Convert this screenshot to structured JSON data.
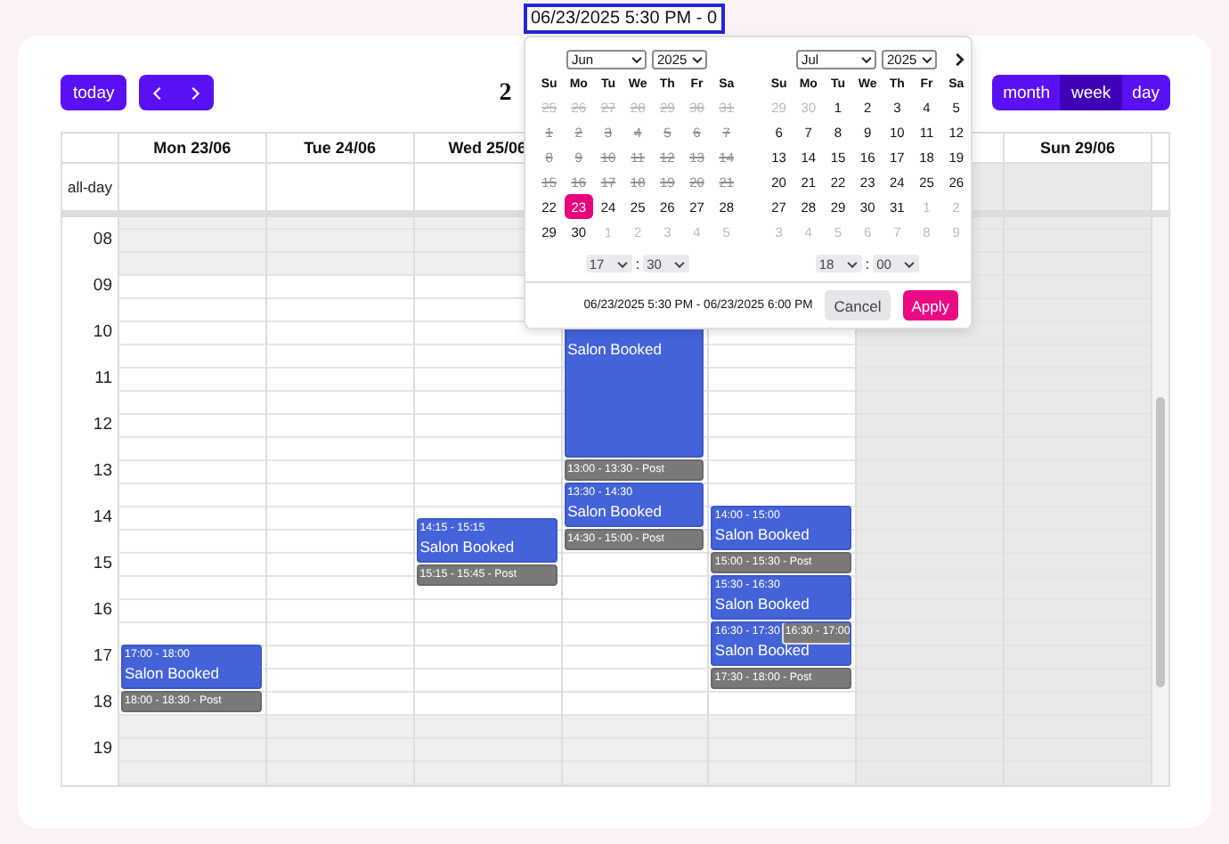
{
  "range_input": {
    "value": "06/23/2025 5:30 PM - 0"
  },
  "toolbar": {
    "today": "today",
    "title": "2",
    "views": [
      {
        "label": "month",
        "selected": false
      },
      {
        "label": "week",
        "selected": true
      },
      {
        "label": "day",
        "selected": false
      }
    ]
  },
  "calendar": {
    "all_day_label": "all-day",
    "hours": [
      "08",
      "09",
      "10",
      "11",
      "12",
      "13",
      "14",
      "15",
      "16",
      "17",
      "18",
      "19"
    ],
    "days": [
      {
        "header": "Mon 23/06",
        "weekend": false,
        "events": [
          {
            "kind": "booking",
            "time": "17:00 - 18:00",
            "title": "Salon Booked"
          },
          {
            "kind": "post",
            "time": "18:00 - 18:30 - Post"
          }
        ]
      },
      {
        "header": "Tue 24/06",
        "weekend": false
      },
      {
        "header": "Wed 25/06",
        "weekend": false,
        "events": [
          {
            "kind": "booking",
            "time": "14:15 - 15:15",
            "title": "Salon Booked"
          },
          {
            "kind": "post",
            "time": "15:15 - 15:45 - Post"
          }
        ]
      },
      {
        "weekend": false,
        "events": [
          {
            "kind": "booking",
            "title": "Salon Booked"
          },
          {
            "kind": "post",
            "time": "13:00 - 13:30 - Post"
          },
          {
            "kind": "booking",
            "time": "13:30 - 14:30",
            "title": "Salon Booked"
          },
          {
            "kind": "post",
            "time": "14:30 - 15:00 - Post"
          }
        ]
      },
      {
        "weekend": false,
        "events": [
          {
            "kind": "booking",
            "time": "14:00 - 15:00",
            "title": "Salon Booked"
          },
          {
            "kind": "post",
            "time": "15:00 - 15:30 - Post"
          },
          {
            "kind": "booking",
            "time": "15:30 - 16:30",
            "title": "Salon Booked"
          },
          {
            "kind": "booking",
            "time": "16:30 - 17:30",
            "title": "Salon Booked"
          },
          {
            "kind": "post",
            "time": "16:30 - 17:00",
            "inset": true
          },
          {
            "kind": "post",
            "time": "17:30 - 18:00 - Post"
          }
        ]
      },
      {
        "weekend": true
      },
      {
        "header": "Sun 29/06",
        "weekend": true
      }
    ]
  },
  "picker": {
    "months": [
      {
        "month": "Jun",
        "year": "2025",
        "weekdays": [
          "Su",
          "Mo",
          "Tu",
          "We",
          "Th",
          "Fr",
          "Sa"
        ],
        "weeks": [
          [
            {
              "label": "25",
              "outside": true,
              "disabled": true,
              "selected": false
            },
            {
              "label": "26",
              "outside": true,
              "disabled": true,
              "selected": false
            },
            {
              "label": "27",
              "outside": true,
              "disabled": true,
              "selected": false
            },
            {
              "label": "28",
              "outside": true,
              "disabled": true,
              "selected": false
            },
            {
              "label": "29",
              "outside": true,
              "disabled": true,
              "selected": false
            },
            {
              "label": "30",
              "outside": true,
              "disabled": true,
              "selected": false
            },
            {
              "label": "31",
              "outside": true,
              "disabled": true,
              "selected": false
            }
          ],
          [
            {
              "label": "1",
              "outside": false,
              "disabled": true,
              "selected": false
            },
            {
              "label": "2",
              "outside": false,
              "disabled": true,
              "selected": false
            },
            {
              "label": "3",
              "outside": false,
              "disabled": true,
              "selected": false
            },
            {
              "label": "4",
              "outside": false,
              "disabled": true,
              "selected": false
            },
            {
              "label": "5",
              "outside": false,
              "disabled": true,
              "selected": false
            },
            {
              "label": "6",
              "outside": false,
              "disabled": true,
              "selected": false
            },
            {
              "label": "7",
              "outside": false,
              "disabled": true,
              "selected": false
            }
          ],
          [
            {
              "label": "8",
              "outside": false,
              "disabled": true,
              "selected": false
            },
            {
              "label": "9",
              "outside": false,
              "disabled": true,
              "selected": false
            },
            {
              "label": "10",
              "outside": false,
              "disabled": true,
              "selected": false
            },
            {
              "label": "11",
              "outside": false,
              "disabled": true,
              "selected": false
            },
            {
              "label": "12",
              "outside": false,
              "disabled": true,
              "selected": false
            },
            {
              "label": "13",
              "outside": false,
              "disabled": true,
              "selected": false
            },
            {
              "label": "14",
              "outside": false,
              "disabled": true,
              "selected": false
            }
          ],
          [
            {
              "label": "15",
              "outside": false,
              "disabled": true,
              "selected": false
            },
            {
              "label": "16",
              "outside": false,
              "disabled": true,
              "selected": false
            },
            {
              "label": "17",
              "outside": false,
              "disabled": true,
              "selected": false
            },
            {
              "label": "18",
              "outside": false,
              "disabled": true,
              "selected": false
            },
            {
              "label": "19",
              "outside": false,
              "disabled": true,
              "selected": false
            },
            {
              "label": "20",
              "outside": false,
              "disabled": true,
              "selected": false
            },
            {
              "label": "21",
              "outside": false,
              "disabled": true,
              "selected": false
            }
          ],
          [
            {
              "label": "22",
              "outside": false,
              "disabled": false,
              "selected": false
            },
            {
              "label": "23",
              "outside": false,
              "disabled": false,
              "selected": true
            },
            {
              "label": "24",
              "outside": false,
              "disabled": false,
              "selected": false
            },
            {
              "label": "25",
              "outside": false,
              "disabled": false,
              "selected": false
            },
            {
              "label": "26",
              "outside": false,
              "disabled": false,
              "selected": false
            },
            {
              "label": "27",
              "outside": false,
              "disabled": false,
              "selected": false
            },
            {
              "label": "28",
              "outside": false,
              "disabled": false,
              "selected": false
            }
          ],
          [
            {
              "label": "29",
              "outside": false,
              "disabled": false,
              "selected": false
            },
            {
              "label": "30",
              "outside": false,
              "disabled": false,
              "selected": false
            },
            {
              "label": "1",
              "outside": true,
              "disabled": false,
              "selected": false
            },
            {
              "label": "2",
              "outside": true,
              "disabled": false,
              "selected": false
            },
            {
              "label": "3",
              "outside": true,
              "disabled": false,
              "selected": false
            },
            {
              "label": "4",
              "outside": true,
              "disabled": false,
              "selected": false
            },
            {
              "label": "5",
              "outside": true,
              "disabled": false,
              "selected": false
            }
          ]
        ],
        "time": {
          "hour": "17",
          "separator": ":",
          "minute": "30"
        }
      },
      {
        "month": "Jul",
        "year": "2025",
        "weekdays": [
          "Su",
          "Mo",
          "Tu",
          "We",
          "Th",
          "Fr",
          "Sa"
        ],
        "weeks": [
          [
            {
              "label": "29",
              "outside": true,
              "disabled": false,
              "selected": false
            },
            {
              "label": "30",
              "outside": true,
              "disabled": false,
              "selected": false
            },
            {
              "label": "1",
              "outside": false,
              "disabled": false,
              "selected": false
            },
            {
              "label": "2",
              "outside": false,
              "disabled": false,
              "selected": false
            },
            {
              "label": "3",
              "outside": false,
              "disabled": false,
              "selected": false
            },
            {
              "label": "4",
              "outside": false,
              "disabled": false,
              "selected": false
            },
            {
              "label": "5",
              "outside": false,
              "disabled": false,
              "selected": false
            }
          ],
          [
            {
              "label": "6",
              "outside": false,
              "disabled": false,
              "selected": false
            },
            {
              "label": "7",
              "outside": false,
              "disabled": false,
              "selected": false
            },
            {
              "label": "8",
              "outside": false,
              "disabled": false,
              "selected": false
            },
            {
              "label": "9",
              "outside": false,
              "disabled": false,
              "selected": false
            },
            {
              "label": "10",
              "outside": false,
              "disabled": false,
              "selected": false
            },
            {
              "label": "11",
              "outside": false,
              "disabled": false,
              "selected": false
            },
            {
              "label": "12",
              "outside": false,
              "disabled": false,
              "selected": false
            }
          ],
          [
            {
              "label": "13",
              "outside": false,
              "disabled": false,
              "selected": false
            },
            {
              "label": "14",
              "outside": false,
              "disabled": false,
              "selected": false
            },
            {
              "label": "15",
              "outside": false,
              "disabled": false,
              "selected": false
            },
            {
              "label": "16",
              "outside": false,
              "disabled": false,
              "selected": false
            },
            {
              "label": "17",
              "outside": false,
              "disabled": false,
              "selected": false
            },
            {
              "label": "18",
              "outside": false,
              "disabled": false,
              "selected": false
            },
            {
              "label": "19",
              "outside": false,
              "disabled": false,
              "selected": false
            }
          ],
          [
            {
              "label": "20",
              "outside": false,
              "disabled": false,
              "selected": false
            },
            {
              "label": "21",
              "outside": false,
              "disabled": false,
              "selected": false
            },
            {
              "label": "22",
              "outside": false,
              "disabled": false,
              "selected": false
            },
            {
              "label": "23",
              "outside": false,
              "disabled": false,
              "selected": false
            },
            {
              "label": "24",
              "outside": false,
              "disabled": false,
              "selected": false
            },
            {
              "label": "25",
              "outside": false,
              "disabled": false,
              "selected": false
            },
            {
              "label": "26",
              "outside": false,
              "disabled": false,
              "selected": false
            }
          ],
          [
            {
              "label": "27",
              "outside": false,
              "disabled": false,
              "selected": false
            },
            {
              "label": "28",
              "outside": false,
              "disabled": false,
              "selected": false
            },
            {
              "label": "29",
              "outside": false,
              "disabled": false,
              "selected": false
            },
            {
              "label": "30",
              "outside": false,
              "disabled": false,
              "selected": false
            },
            {
              "label": "31",
              "outside": false,
              "disabled": false,
              "selected": false
            },
            {
              "label": "1",
              "outside": true,
              "disabled": false,
              "selected": false
            },
            {
              "label": "2",
              "outside": true,
              "disabled": false,
              "selected": false
            }
          ],
          [
            {
              "label": "3",
              "outside": true,
              "disabled": false,
              "selected": false
            },
            {
              "label": "4",
              "outside": true,
              "disabled": false,
              "selected": false
            },
            {
              "label": "5",
              "outside": true,
              "disabled": false,
              "selected": false
            },
            {
              "label": "6",
              "outside": true,
              "disabled": false,
              "selected": false
            },
            {
              "label": "7",
              "outside": true,
              "disabled": false,
              "selected": false
            },
            {
              "label": "8",
              "outside": true,
              "disabled": false,
              "selected": false
            },
            {
              "label": "9",
              "outside": true,
              "disabled": false,
              "selected": false
            }
          ]
        ],
        "time": {
          "hour": "18",
          "separator": ":",
          "minute": "00"
        }
      }
    ],
    "summary": "06/23/2025 5:30 PM - 06/23/2025 6:00 PM",
    "cancel": "Cancel",
    "apply": "Apply"
  }
}
